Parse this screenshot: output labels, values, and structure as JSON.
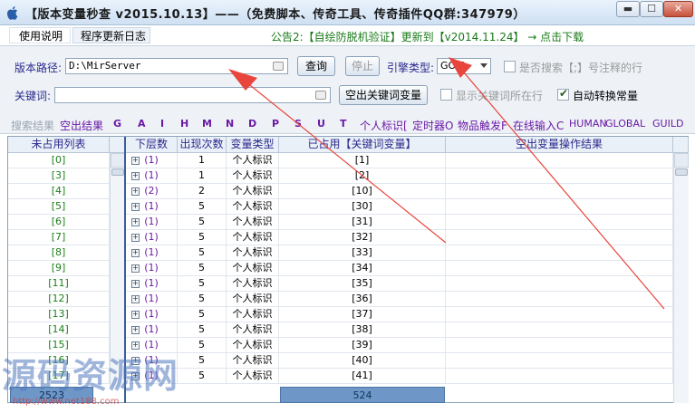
{
  "window": {
    "title": "【版本变量秒查 v2015.10.13】——（免费脚本、传奇工具、传奇插件QQ群:347979）",
    "minimize_glyph": "▬",
    "maximize_glyph": "☐",
    "close_glyph": "✕"
  },
  "menu": {
    "help": "使用说明",
    "update_log": "程序更新日志",
    "notice": "公告2:【自绘防脱机验证】更新到【v2014.11.24】 → 点击下载"
  },
  "form": {
    "path_label": "版本路径:",
    "path_value": "D:\\MirServer",
    "query_button": "查询",
    "stop_button": "停止",
    "engine_label": "引擎类型:",
    "engine_value": "GOM",
    "search_comment_label": "是否搜索【;】号注释的行",
    "search_comment_checked": false,
    "keyword_label": "关键词:",
    "keyword_value": "",
    "empty_keyword_button": "空出关键词变量",
    "show_keyword_lines_label": "显示关键词所在行",
    "show_keyword_lines_checked": false,
    "auto_convert_label": "自动转换常量",
    "auto_convert_checked": true
  },
  "filters": {
    "label": "搜索结果",
    "items": [
      "空出结果",
      "G",
      "A",
      "I",
      "H",
      "M",
      "N",
      "D",
      "P",
      "S",
      "U",
      "T",
      "个人标识[",
      "定时器O",
      "物品触发F",
      "在线输入C",
      "HUMAN",
      "GLOBAL",
      "GUILD"
    ]
  },
  "unused_list": {
    "header": "未占用列表",
    "items": [
      "[0]",
      "[3]",
      "[4]",
      "[5]",
      "[6]",
      "[7]",
      "[8]",
      "[9]",
      "[11]",
      "[12]",
      "[13]",
      "[14]",
      "[15]",
      "[16]",
      "[17]"
    ],
    "count": "2523"
  },
  "used_table": {
    "headers": [
      "下层数",
      "出现次数",
      "变量类型",
      "已占用【关键词变量】",
      "空出变量操作结果"
    ],
    "rows": [
      {
        "level": "(1)",
        "count": "1",
        "type": "个人标识",
        "var": "[1]"
      },
      {
        "level": "(1)",
        "count": "1",
        "type": "个人标识",
        "var": "[2]"
      },
      {
        "level": "(2)",
        "count": "2",
        "type": "个人标识",
        "var": "[10]"
      },
      {
        "level": "(1)",
        "count": "5",
        "type": "个人标识",
        "var": "[30]"
      },
      {
        "level": "(1)",
        "count": "5",
        "type": "个人标识",
        "var": "[31]"
      },
      {
        "level": "(1)",
        "count": "5",
        "type": "个人标识",
        "var": "[32]"
      },
      {
        "level": "(1)",
        "count": "5",
        "type": "个人标识",
        "var": "[33]"
      },
      {
        "level": "(1)",
        "count": "5",
        "type": "个人标识",
        "var": "[34]"
      },
      {
        "level": "(1)",
        "count": "5",
        "type": "个人标识",
        "var": "[35]"
      },
      {
        "level": "(1)",
        "count": "5",
        "type": "个人标识",
        "var": "[36]"
      },
      {
        "level": "(1)",
        "count": "5",
        "type": "个人标识",
        "var": "[37]"
      },
      {
        "level": "(1)",
        "count": "5",
        "type": "个人标识",
        "var": "[38]"
      },
      {
        "level": "(1)",
        "count": "5",
        "type": "个人标识",
        "var": "[39]"
      },
      {
        "level": "(1)",
        "count": "5",
        "type": "个人标识",
        "var": "[40]"
      },
      {
        "level": "(1)",
        "count": "5",
        "type": "个人标识",
        "var": "[41]"
      }
    ],
    "used_count": "524"
  },
  "watermark": {
    "text": "源码资源网",
    "url": "http://www.net188.com"
  },
  "colors": {
    "accent_blue": "#2a2a8c",
    "green_text": "#1c7f1c",
    "purple_text": "#6a1aa6",
    "annotation_red": "#e8453c"
  }
}
